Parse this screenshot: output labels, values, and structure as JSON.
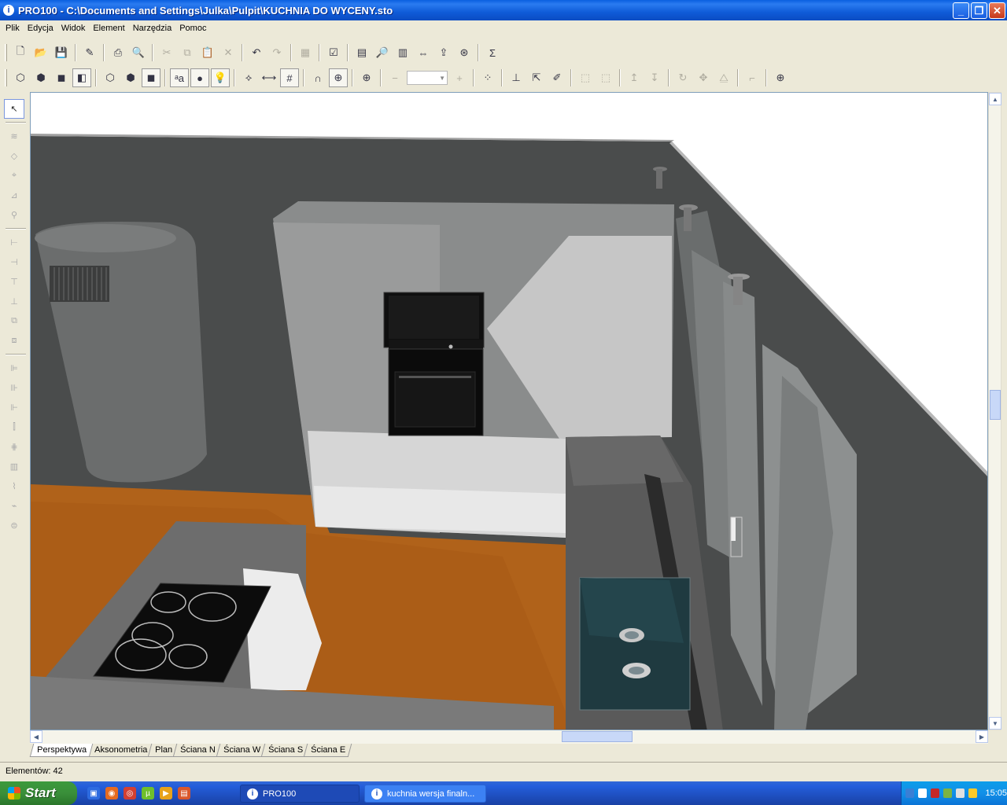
{
  "window": {
    "title": "PRO100 - C:\\Documents and Settings\\Julka\\Pulpit\\KUCHNIA DO WYCENY.sto",
    "app_icon": "i",
    "buttons": {
      "minimize": "_",
      "maximize": "❐",
      "close": "✕"
    }
  },
  "menu": [
    "Plik",
    "Edycja",
    "Widok",
    "Element",
    "Narzędzia",
    "Pomoc"
  ],
  "toolbar1": [
    {
      "icon": "new-file-icon",
      "glyph": "🗋"
    },
    {
      "icon": "open-folder-icon",
      "glyph": "📂"
    },
    {
      "icon": "save-icon",
      "glyph": "💾"
    },
    {
      "sep": true
    },
    {
      "icon": "properties-icon",
      "glyph": "✎"
    },
    {
      "sep": true
    },
    {
      "icon": "print-icon",
      "glyph": "⎙"
    },
    {
      "icon": "print-preview-icon",
      "glyph": "🔍"
    },
    {
      "sep": true
    },
    {
      "icon": "cut-icon",
      "glyph": "✂",
      "dim": true
    },
    {
      "icon": "copy-icon",
      "glyph": "⧉",
      "dim": true
    },
    {
      "icon": "paste-icon",
      "glyph": "📋",
      "dim": true
    },
    {
      "icon": "delete-icon",
      "glyph": "✕",
      "dim": true
    },
    {
      "sep": true
    },
    {
      "icon": "undo-icon",
      "glyph": "↶"
    },
    {
      "icon": "redo-icon",
      "glyph": "↷",
      "dim": true
    },
    {
      "sep": true
    },
    {
      "icon": "library-icon",
      "glyph": "▦",
      "dim": true
    },
    {
      "sep": true
    },
    {
      "icon": "checklist-icon",
      "glyph": "☑"
    },
    {
      "sep": true
    },
    {
      "icon": "report-icon",
      "glyph": "▤"
    },
    {
      "icon": "preview-report-icon",
      "glyph": "🔎"
    },
    {
      "icon": "tree-report-icon",
      "glyph": "▥"
    },
    {
      "icon": "cutting-list-icon",
      "glyph": "⇔"
    },
    {
      "icon": "export-icon",
      "glyph": "⇪"
    },
    {
      "icon": "pricing-icon",
      "glyph": "⊛"
    },
    {
      "sep": true
    },
    {
      "icon": "sum-icon",
      "glyph": "Σ"
    }
  ],
  "toolbar2": [
    {
      "icon": "wireframe-view-icon",
      "glyph": "⬡"
    },
    {
      "icon": "hidden-lines-view-icon",
      "glyph": "⬢"
    },
    {
      "icon": "shaded-view-icon",
      "glyph": "◼"
    },
    {
      "icon": "textured-view-icon",
      "glyph": "◧",
      "pressed": true
    },
    {
      "sep": true
    },
    {
      "icon": "box-wire-icon",
      "glyph": "⬡"
    },
    {
      "icon": "box-hidden-icon",
      "glyph": "⬢"
    },
    {
      "icon": "box-solid-icon",
      "glyph": "◼",
      "pressed": true
    },
    {
      "sep": true
    },
    {
      "icon": "text-labels-icon",
      "glyph": "ᵃa",
      "pressed": true
    },
    {
      "icon": "materials-icon",
      "glyph": "●",
      "pressed": true
    },
    {
      "icon": "light-bulb-icon",
      "glyph": "💡",
      "pressed": true
    },
    {
      "sep": true
    },
    {
      "icon": "dimension-icon",
      "glyph": "⟡"
    },
    {
      "icon": "measure-icon",
      "glyph": "⟷"
    },
    {
      "icon": "grid-icon",
      "glyph": "#",
      "pressed": true
    },
    {
      "sep": true
    },
    {
      "icon": "magnet-icon",
      "glyph": "∩"
    },
    {
      "icon": "snap-target-icon",
      "glyph": "⊕",
      "pressed": true
    },
    {
      "sep": true
    },
    {
      "icon": "target-icon",
      "glyph": "⊕"
    },
    {
      "sep": true
    },
    {
      "icon": "zoom-out-icon",
      "glyph": "−",
      "dim": true
    },
    {
      "zoom": true
    },
    {
      "icon": "zoom-in-icon",
      "glyph": "+",
      "dim": true
    },
    {
      "sep": true
    },
    {
      "icon": "select-all-icon",
      "glyph": "⁘"
    },
    {
      "sep": true
    },
    {
      "icon": "align-icon",
      "glyph": "⊥"
    },
    {
      "icon": "move-cursor-icon",
      "glyph": "⇱"
    },
    {
      "icon": "pen-icon",
      "glyph": "✐"
    },
    {
      "sep": true
    },
    {
      "icon": "group-icon",
      "glyph": "⬚",
      "dim": true
    },
    {
      "icon": "ungroup-icon",
      "glyph": "⬚",
      "dim": true
    },
    {
      "sep": true
    },
    {
      "icon": "move-up-icon",
      "glyph": "↥",
      "dim": true
    },
    {
      "icon": "move-down-icon",
      "glyph": "↧",
      "dim": true
    },
    {
      "sep": true
    },
    {
      "icon": "rotate-icon",
      "glyph": "↻",
      "dim": true
    },
    {
      "icon": "move-icon",
      "glyph": "✥",
      "dim": true
    },
    {
      "icon": "mirror-icon",
      "glyph": "⧋",
      "dim": true
    },
    {
      "sep": true
    },
    {
      "icon": "shelf-icon",
      "glyph": "⌐",
      "dim": true
    },
    {
      "sep": true
    },
    {
      "icon": "target-red-icon",
      "glyph": "⊕"
    }
  ],
  "left_tools": [
    {
      "icon": "pointer-icon",
      "glyph": "↖",
      "on": true
    },
    {
      "sep": true
    },
    {
      "icon": "parallel-move-icon",
      "glyph": "≋"
    },
    {
      "icon": "rotate-element-icon",
      "glyph": "◇"
    },
    {
      "icon": "edit-shape-icon",
      "glyph": "⌖"
    },
    {
      "icon": "edit-drawer-icon",
      "glyph": "⊿"
    },
    {
      "icon": "zoom-element-icon",
      "glyph": "⚲"
    },
    {
      "sep": true
    },
    {
      "icon": "align-left-icon",
      "glyph": "⊢"
    },
    {
      "icon": "align-center-icon",
      "glyph": "⊣"
    },
    {
      "icon": "align-top-icon",
      "glyph": "⊤"
    },
    {
      "icon": "align-bottom-icon",
      "glyph": "⊥"
    },
    {
      "icon": "distribute-h-icon",
      "glyph": "⧉"
    },
    {
      "icon": "distribute-v-icon",
      "glyph": "⧈"
    },
    {
      "sep": true
    },
    {
      "icon": "stack-left-icon",
      "glyph": "⊫"
    },
    {
      "icon": "stack-center-icon",
      "glyph": "⊪"
    },
    {
      "icon": "stack-right-icon",
      "glyph": "⊩"
    },
    {
      "icon": "equal-width-icon",
      "glyph": "⫿"
    },
    {
      "icon": "equal-height-icon",
      "glyph": "⋕"
    },
    {
      "icon": "chart-tool-icon",
      "glyph": "▥"
    },
    {
      "icon": "paint-tool-icon",
      "glyph": "⌇"
    },
    {
      "icon": "wrench-tool-icon",
      "glyph": "⌁"
    },
    {
      "icon": "stamp-tool-icon",
      "glyph": "⊜"
    }
  ],
  "view_tabs": [
    "Perspektywa",
    "Aksonometria",
    "Plan",
    "Ściana N",
    "Ściana W",
    "Ściana S",
    "Ściana E"
  ],
  "active_tab": 0,
  "status": {
    "elements_label": "Elementów: 42"
  },
  "taskbar": {
    "start_label": "Start",
    "quick_launch": [
      {
        "icon": "show-desktop-icon",
        "color": "#2d6be0",
        "glyph": "▣"
      },
      {
        "icon": "firefox-icon",
        "color": "#e66a1f",
        "glyph": "◉"
      },
      {
        "icon": "chrome-icon",
        "color": "#d33f32",
        "glyph": "◎"
      },
      {
        "icon": "utorrent-icon",
        "color": "#6fbf2b",
        "glyph": "µ"
      },
      {
        "icon": "media-player-icon",
        "color": "#e7a21b",
        "glyph": "▶"
      },
      {
        "icon": "document-icon",
        "color": "#d9572b",
        "glyph": "▤"
      }
    ],
    "tasks": [
      {
        "label": "PRO100",
        "active": true
      },
      {
        "label": "kuchnia wersja finaln...",
        "active": false
      }
    ],
    "clock": "15:05",
    "tray_icons": [
      {
        "icon": "tray-arrow-icon",
        "color": "#3a7fd5"
      },
      {
        "icon": "tray-speech-icon",
        "color": "#ffffff"
      },
      {
        "icon": "tray-shield-icon",
        "color": "#c62828"
      },
      {
        "icon": "tray-network-icon",
        "color": "#7cb342"
      },
      {
        "icon": "tray-volume-icon",
        "color": "#e0e0e0"
      },
      {
        "icon": "tray-update-icon",
        "color": "#ffca28"
      }
    ]
  }
}
